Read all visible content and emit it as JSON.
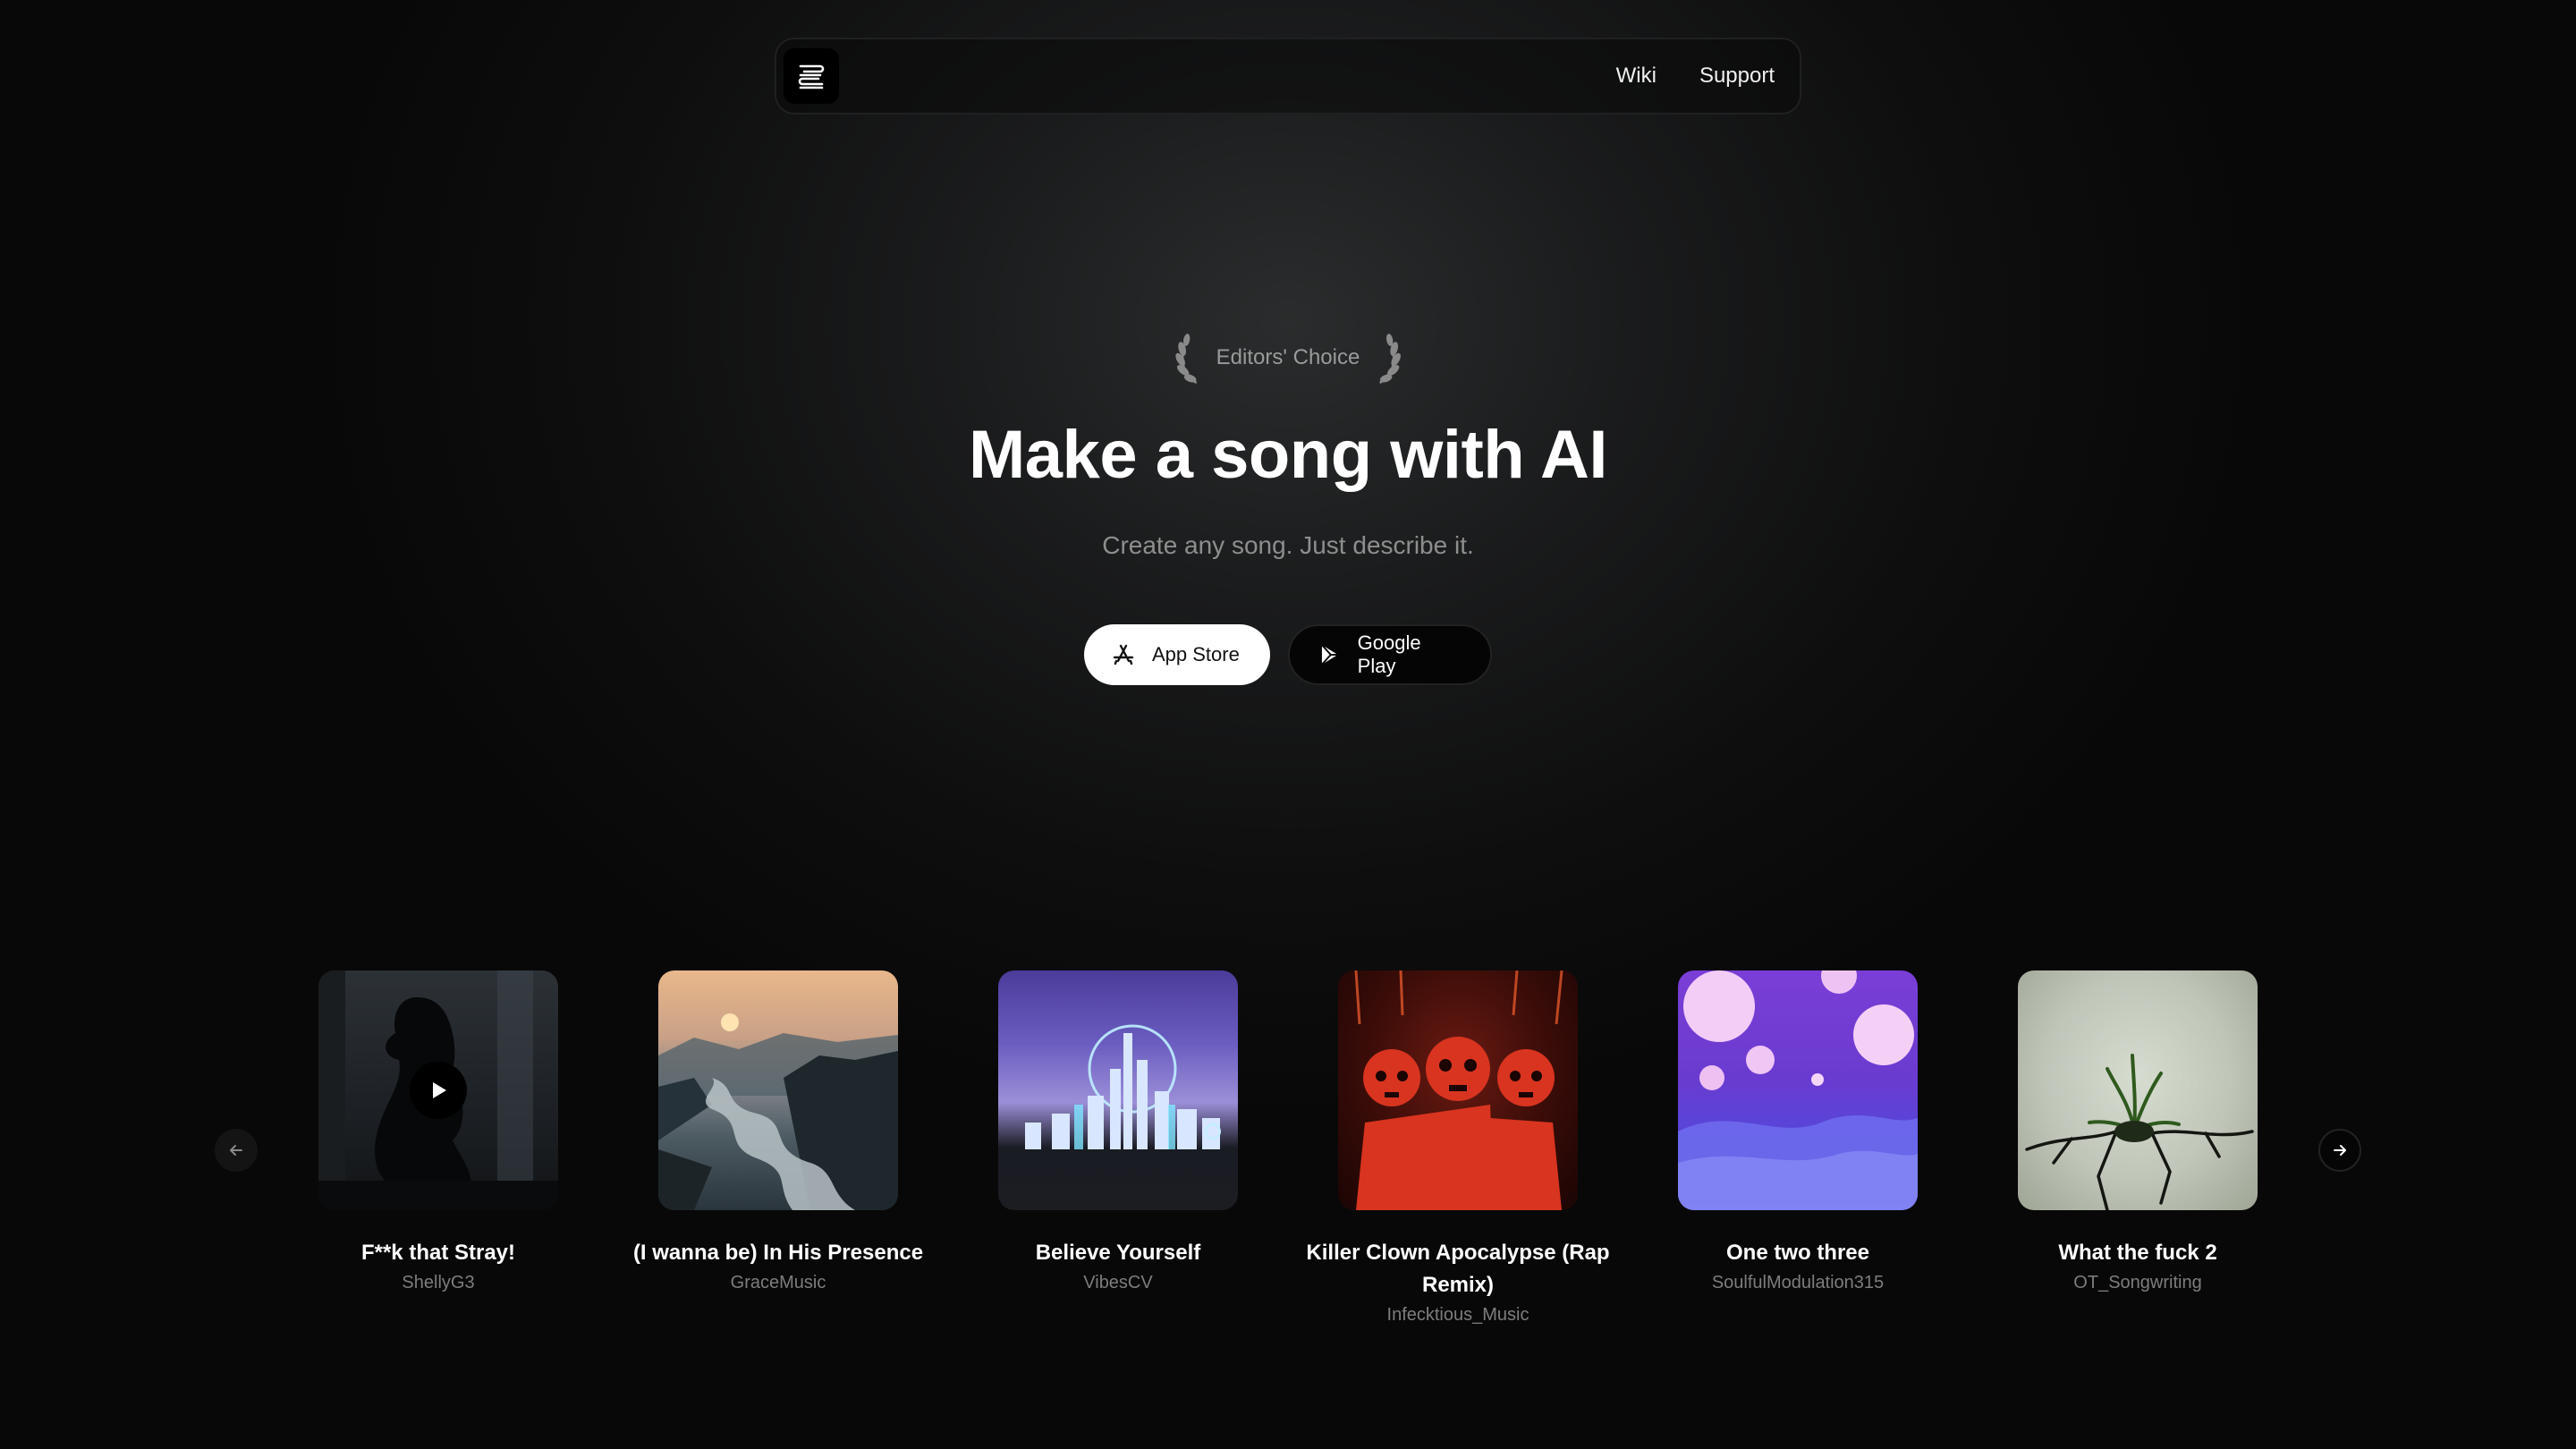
{
  "nav": {
    "logo_icon": "stacked-lines-logo-icon",
    "links": [
      "Wiki",
      "Support"
    ]
  },
  "hero": {
    "badge": "Editors' Choice",
    "title": "Make a song with AI",
    "subtitle": "Create any song. Just describe it.",
    "app_store": "App Store",
    "google_play": "Google Play"
  },
  "carousel": {
    "songs": [
      {
        "title": "F**k that Stray!",
        "artist": "ShellyG3"
      },
      {
        "title": "(I wanna be) In His Presence",
        "artist": "GraceMusic"
      },
      {
        "title": "Believe Yourself",
        "artist": "VibesCV"
      },
      {
        "title": "Killer Clown Apocalypse (Rap Remix)",
        "artist": "Infecktious_Music"
      },
      {
        "title": "One two three",
        "artist": "SoulfulModulation315"
      },
      {
        "title": "What the fuck 2",
        "artist": "OT_Songwriting"
      }
    ]
  },
  "colors": {
    "background": "#0b0b0b",
    "primary_text": "#ffffff",
    "muted_text": "#8e8e8e"
  }
}
